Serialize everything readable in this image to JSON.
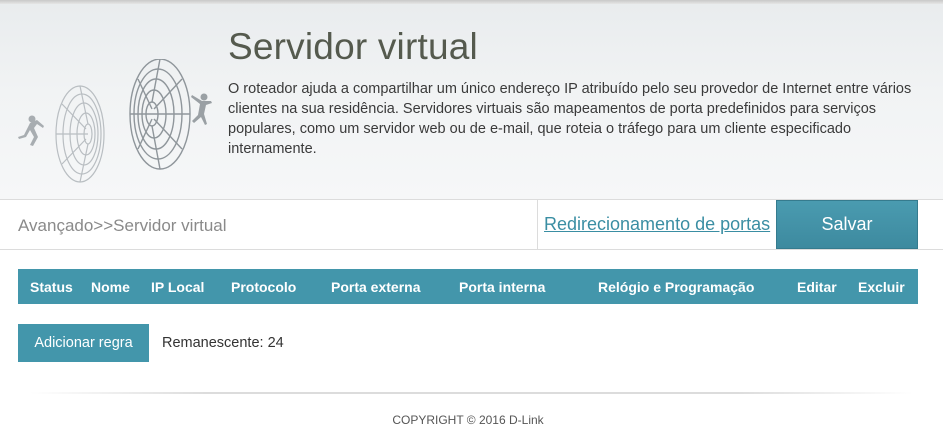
{
  "banner": {
    "title": "Servidor virtual",
    "description": "O roteador ajuda a compartilhar um único endereço IP atribuído pelo seu provedor de Internet entre vários clientes na sua residência. Servidores virtuais são mapeamentos de porta predefinidos para serviços populares, como um servidor web ou de e-mail, que roteia o tráfego para um cliente especificado internamente.",
    "art_icon": "tunnel-runner-illustration"
  },
  "toolbar": {
    "breadcrumb": "Avançado>>Servidor virtual",
    "port_forwarding_link": "Redirecionamento de portas",
    "save_label": "Salvar"
  },
  "table": {
    "columns": [
      "Status",
      "Nome",
      "IP Local",
      "Protocolo",
      "Porta externa",
      "Porta interna",
      "Relógio e Programação",
      "Editar",
      "Excluir"
    ],
    "rows": []
  },
  "actions": {
    "add_rule_label": "Adicionar regra",
    "remaining_label": "Remanescente:",
    "remaining_count": "24"
  },
  "footer": {
    "copyright": "COPYRIGHT © 2016 D-Link"
  },
  "colors": {
    "accent": "#4396ab",
    "link": "#3a8ea3",
    "title": "#555a4e"
  }
}
